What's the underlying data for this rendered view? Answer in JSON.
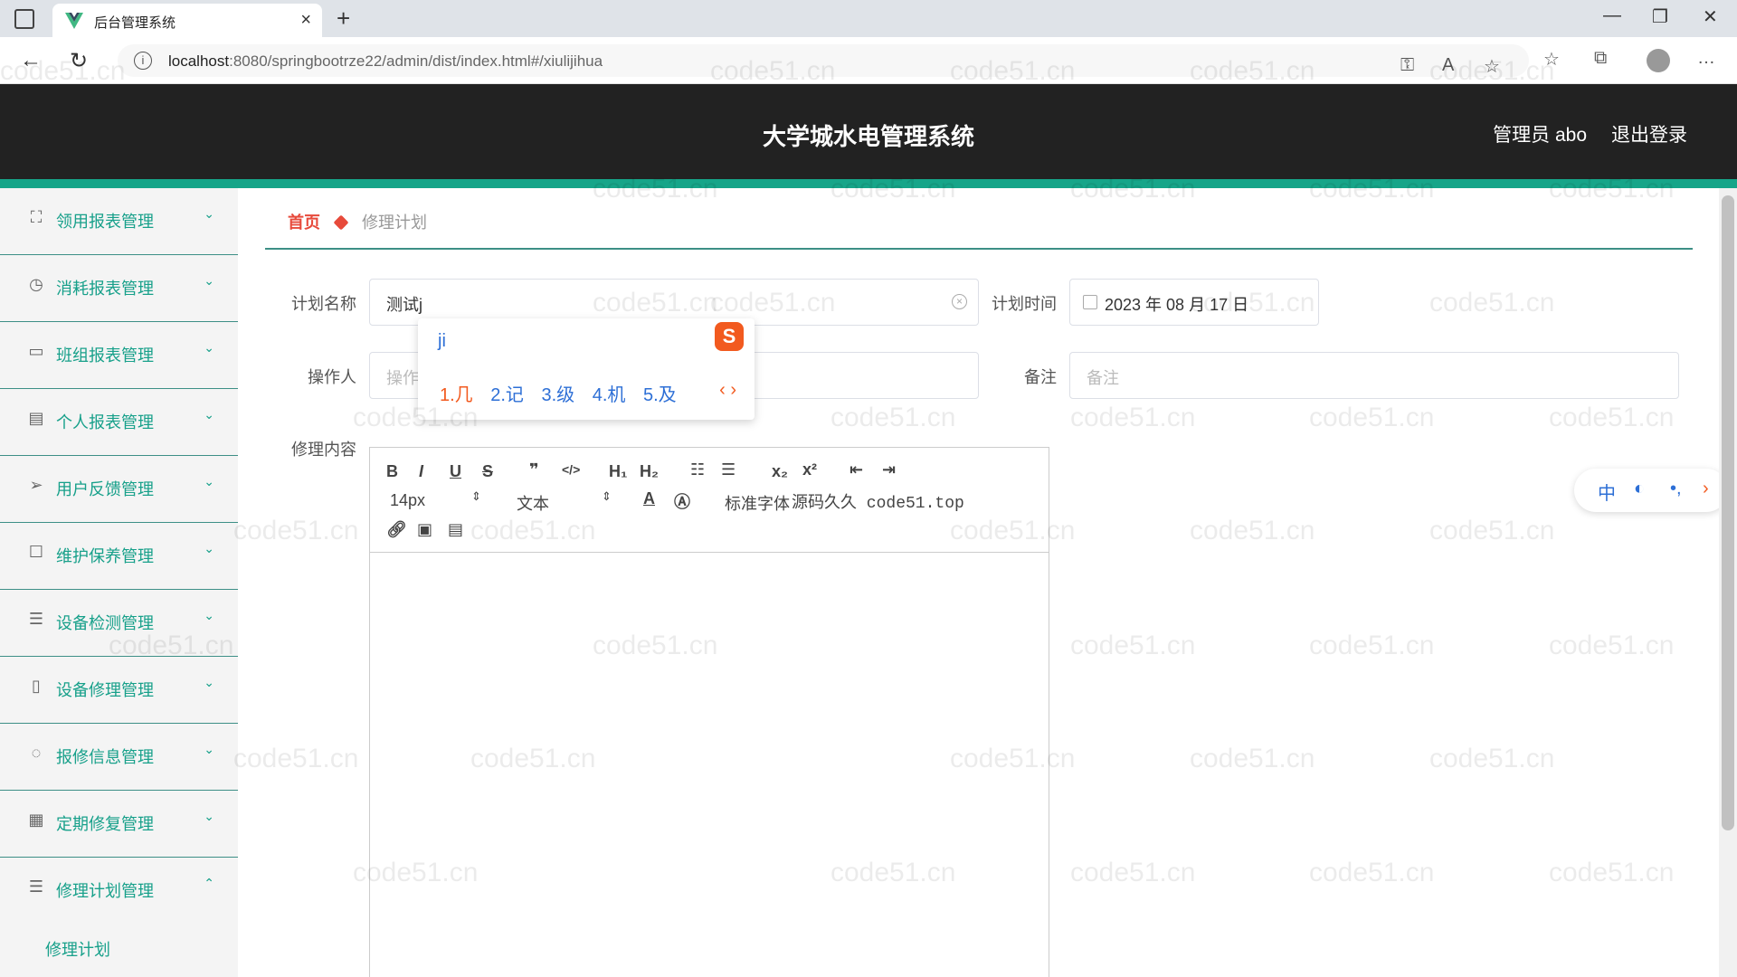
{
  "browser": {
    "tab_title": "后台管理系统",
    "url_host": "localhost",
    "url_path": ":8080/springbootrze22/admin/dist/index.html#/xiulijihua"
  },
  "header": {
    "title": "大学城水电管理系统",
    "user": "管理员 abo",
    "logout": "退出登录"
  },
  "sidebar": {
    "items": [
      {
        "label": "领用报表管理",
        "icon": "expand-icon"
      },
      {
        "label": "消耗报表管理",
        "icon": "clock-icon"
      },
      {
        "label": "班组报表管理",
        "icon": "card-icon"
      },
      {
        "label": "个人报表管理",
        "icon": "clipboard-icon"
      },
      {
        "label": "用户反馈管理",
        "icon": "send-icon"
      },
      {
        "label": "维护保养管理",
        "icon": "square-icon"
      },
      {
        "label": "设备检测管理",
        "icon": "list-icon"
      },
      {
        "label": "设备修理管理",
        "icon": "mobile-icon"
      },
      {
        "label": "报修信息管理",
        "icon": "mic-icon"
      },
      {
        "label": "定期修复管理",
        "icon": "grid-icon"
      },
      {
        "label": "修理计划管理",
        "icon": "menu-icon"
      }
    ],
    "sub_item": "修理计划"
  },
  "breadcrumb": {
    "home": "首页",
    "current": "修理计划"
  },
  "form": {
    "plan_name_label": "计划名称",
    "plan_name_value": "测试j",
    "plan_time_label": "计划时间",
    "plan_time_value": "2023 年 08 月 17 日",
    "operator_label": "操作人",
    "operator_placeholder": "操作",
    "remark_label": "备注",
    "remark_placeholder": "备注",
    "content_label": "修理内容"
  },
  "editor": {
    "font_size": "14px",
    "block_type": "文本",
    "font_family": "标准字体",
    "overlay_text": "源码久久 code51.top"
  },
  "ime": {
    "pinyin": "ji",
    "candidates": [
      "1.几",
      "2.记",
      "3.级",
      "4.机",
      "5.及"
    ],
    "bar": [
      "中",
      "◐",
      "•,"
    ]
  },
  "watermark": "code51.cn"
}
